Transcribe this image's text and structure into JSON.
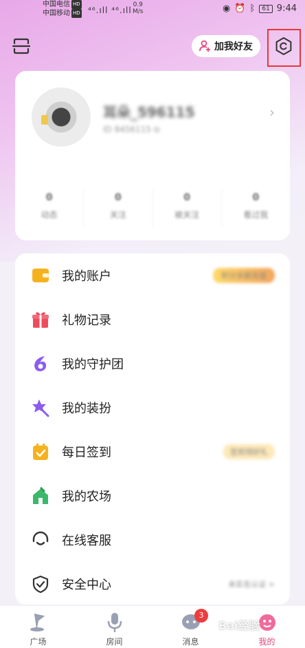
{
  "status_bar": {
    "carrier1": "中国电信",
    "carrier2": "中国移动",
    "hd": "HD",
    "signal": "⁴⁶.ıll ⁴⁶.ıll",
    "speed_value": "0.9",
    "speed_unit": "M/s",
    "battery": "61",
    "time": "9:44"
  },
  "header": {
    "add_friend_label": "加我好友",
    "icons": [
      "scan-icon",
      "add-user-icon",
      "settings-icon"
    ]
  },
  "profile": {
    "username": "耳朵_596115",
    "user_id": "ID 8456115 ⧉",
    "stats": [
      {
        "num": "0",
        "label": "动态"
      },
      {
        "num": "0",
        "label": "关注"
      },
      {
        "num": "0",
        "label": "被关注"
      },
      {
        "num": "0",
        "label": "看过我"
      }
    ]
  },
  "menu": {
    "items": [
      {
        "label": "我的账户",
        "icon": "wallet-icon",
        "color": "#f5b21f",
        "extra": "积分余额充值"
      },
      {
        "label": "礼物记录",
        "icon": "gift-icon",
        "color": "#ef4b5f",
        "extra": ""
      },
      {
        "label": "我的守护团",
        "icon": "guard-icon",
        "color": "#8c5cf0",
        "extra": ""
      },
      {
        "label": "我的装扮",
        "icon": "dress-icon",
        "color": "#8c5cf0",
        "extra": ""
      },
      {
        "label": "每日签到",
        "icon": "checkin-icon",
        "color": "#f5b21f",
        "extra": "签到领好礼"
      },
      {
        "label": "我的农场",
        "icon": "farm-icon",
        "color": "#3cb86a",
        "extra": ""
      },
      {
        "label": "在线客服",
        "icon": "headset-icon",
        "color": "#333333",
        "extra": ""
      },
      {
        "label": "安全中心",
        "icon": "shield-icon",
        "color": "#333333",
        "extra": "未实名认证 >"
      }
    ]
  },
  "tabbar": {
    "tabs": [
      {
        "label": "广场",
        "icon": "plaza-icon"
      },
      {
        "label": "房间",
        "icon": "room-icon"
      },
      {
        "label": "消息",
        "icon": "message-icon"
      },
      {
        "label": "我的",
        "icon": "mine-icon"
      }
    ],
    "message_badge": "3",
    "active_color": "#e0467a"
  },
  "watermark": "Bai经验"
}
